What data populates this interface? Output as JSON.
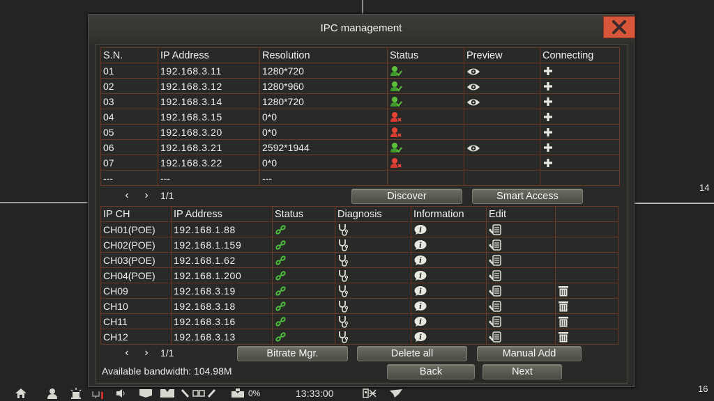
{
  "background": {
    "channel_labels": [
      "14",
      "16"
    ]
  },
  "dialog": {
    "title": "IPC management",
    "close_icon": "close-icon"
  },
  "discovered": {
    "headers": [
      "S.N.",
      "IP Address",
      "Resolution",
      "Status",
      "Preview",
      "Connecting"
    ],
    "rows": [
      {
        "sn": "01",
        "ip": "192.168.3.11",
        "resolution": "1280*720",
        "status": "online",
        "preview": true
      },
      {
        "sn": "02",
        "ip": "192.168.3.12",
        "resolution": "1280*960",
        "status": "online",
        "preview": true
      },
      {
        "sn": "03",
        "ip": "192.168.3.14",
        "resolution": "1280*720",
        "status": "online",
        "preview": true
      },
      {
        "sn": "04",
        "ip": "192.168.3.15",
        "resolution": "0*0",
        "status": "offline",
        "preview": false
      },
      {
        "sn": "05",
        "ip": "192.168.3.20",
        "resolution": "0*0",
        "status": "offline",
        "preview": false
      },
      {
        "sn": "06",
        "ip": "192.168.3.21",
        "resolution": "2592*1944",
        "status": "online",
        "preview": true
      },
      {
        "sn": "07",
        "ip": "192.168.3.22",
        "resolution": "0*0",
        "status": "offline",
        "preview": false
      }
    ],
    "placeholder_row": [
      "---",
      "---",
      "---"
    ],
    "pager": {
      "prev": "‹",
      "next": "›",
      "page": "1/1"
    },
    "buttons": {
      "discover": "Discover",
      "smart_access": "Smart Access"
    }
  },
  "added": {
    "headers": [
      "IP CH",
      "IP Address",
      "Status",
      "Diagnosis",
      "Information",
      "Edit",
      ""
    ],
    "rows": [
      {
        "ch": "CH01(POE)",
        "ip": "192.168.1.88",
        "deletable": false
      },
      {
        "ch": "CH02(POE)",
        "ip": "192.168.1.159",
        "deletable": false
      },
      {
        "ch": "CH03(POE)",
        "ip": "192.168.1.62",
        "deletable": false
      },
      {
        "ch": "CH04(POE)",
        "ip": "192.168.1.200",
        "deletable": false
      },
      {
        "ch": "CH09",
        "ip": "192.168.3.19",
        "deletable": true
      },
      {
        "ch": "CH10",
        "ip": "192.168.3.18",
        "deletable": true
      },
      {
        "ch": "CH11",
        "ip": "192.168.3.16",
        "deletable": true
      },
      {
        "ch": "CH12",
        "ip": "192.168.3.13",
        "deletable": true
      }
    ],
    "pager": {
      "prev": "‹",
      "next": "›",
      "page": "1/1"
    },
    "buttons": {
      "bitrate": "Bitrate Mgr.",
      "delete_all": "Delete all",
      "manual_add": "Manual Add"
    }
  },
  "footer": {
    "bandwidth": "Available bandwidth: 104.98M",
    "back": "Back",
    "next": "Next"
  },
  "taskbar": {
    "percent": "0%",
    "time": "13:33:00",
    "icons": [
      "home-icon",
      "user-icon",
      "alarm-icon",
      "network-icon",
      "audio-icon",
      "playback-icon",
      "record-icon",
      "layout-icon",
      "ptz-icon",
      "hdd-icon",
      "qr-icon",
      "bird-icon"
    ]
  },
  "colors": {
    "close_bg": "#d8573a",
    "online": "#4caf3a",
    "offline": "#e0403a",
    "grid_line": "#6a3a25"
  }
}
